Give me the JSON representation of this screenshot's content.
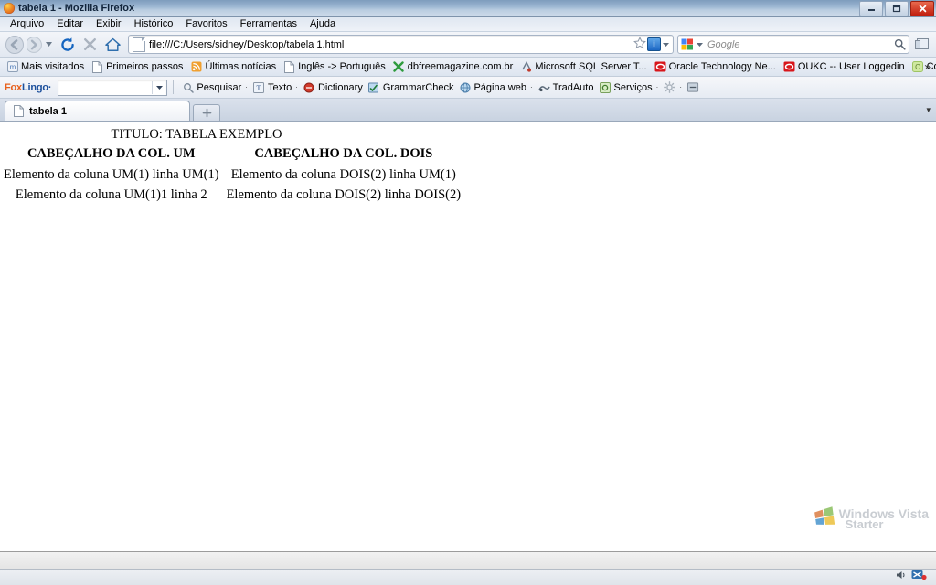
{
  "window": {
    "title": "tabela 1 - Mozilla Firefox",
    "minimize_label": "Minimizar",
    "maximize_label": "Maximizar",
    "close_label": "Fechar"
  },
  "menu": {
    "items": [
      {
        "label": "Arquivo",
        "accel": "A"
      },
      {
        "label": "Editar",
        "accel": "E"
      },
      {
        "label": "Exibir",
        "accel": "x"
      },
      {
        "label": "Histórico",
        "accel": "H"
      },
      {
        "label": "Favoritos",
        "accel": "v"
      },
      {
        "label": "Ferramentas",
        "accel": "F"
      },
      {
        "label": "Ajuda",
        "accel": "j"
      }
    ]
  },
  "navbar": {
    "back_label": "Voltar",
    "forward_label": "Avançar",
    "history_dropdown_label": "Páginas recentes",
    "reload_label": "Recarregar",
    "stop_label": "Parar",
    "home_label": "Página inicial",
    "url": "file:///C:/Users/sidney/Desktop/tabela 1.html",
    "bookmark_star_label": "Adicionar aos favoritos",
    "identity_badge": "i",
    "search": {
      "engine": "Google",
      "placeholder": "Google",
      "value": ""
    },
    "sidebar_button_label": "Painel lateral"
  },
  "bookmarks": {
    "items": [
      {
        "label": "Mais visitados",
        "icon": "most-visited-icon"
      },
      {
        "label": "Primeiros passos",
        "icon": "page-icon"
      },
      {
        "label": "Últimas notícias",
        "icon": "feed-icon"
      },
      {
        "label": "Inglês -> Português",
        "icon": "page-icon"
      },
      {
        "label": "dbfreemagazine.com.br",
        "icon": "green-x-icon"
      },
      {
        "label": "Microsoft SQL Server T...",
        "icon": "sql-server-icon"
      },
      {
        "label": "Oracle Technology Ne...",
        "icon": "oracle-icon"
      },
      {
        "label": "OUKC -- User Loggedin",
        "icon": "oracle-icon"
      },
      {
        "label": "Conjuga-me - Conjug...",
        "icon": "conjugame-icon"
      }
    ],
    "overflow_label": "»"
  },
  "foxlingo": {
    "logo_fox": "Fox",
    "logo_lingo": "Lingo",
    "logo_caret": "·",
    "combo_value": "",
    "items": [
      {
        "label": "Pesquisar",
        "icon": "search-icon",
        "caret": "·"
      },
      {
        "label": "Texto",
        "icon": "text-icon",
        "caret": "·"
      },
      {
        "label": "Dictionary",
        "icon": "dictionary-icon",
        "caret": ""
      },
      {
        "label": "GrammarCheck",
        "icon": "grammar-icon",
        "caret": ""
      },
      {
        "label": "Página web",
        "icon": "webpage-icon",
        "caret": "·"
      },
      {
        "label": "TradAuto",
        "icon": "tradauto-icon",
        "caret": ""
      },
      {
        "label": "Serviços",
        "icon": "services-icon",
        "caret": "·"
      }
    ],
    "settings_label": "Opções",
    "settings_caret": "·",
    "minimize_label": "Recolher barra"
  },
  "tabs": {
    "items": [
      {
        "label": "tabela 1",
        "icon": "page-icon",
        "active": true
      }
    ],
    "new_tab_label": "+",
    "list_all_label": "▾"
  },
  "page": {
    "table": {
      "caption": "TITULO: TABELA EXEMPLO",
      "headers": [
        "CABEÇALHO DA COL. UM",
        "CABEÇALHO DA COL. DOIS"
      ],
      "rows": [
        [
          "Elemento da coluna UM(1) linha UM(1)",
          "Elemento da coluna DOIS(2) linha UM(1)"
        ],
        [
          "Elemento da coluna UM(1)1 linha 2",
          "Elemento da coluna DOIS(2) linha DOIS(2)"
        ]
      ]
    }
  },
  "statusbar": {
    "text": ""
  },
  "watermark": {
    "line1": "Windows Vista",
    "line2": "Starter"
  },
  "colors": {
    "title_bar_top": "#7e9cbd",
    "close_button": "#c01d0d",
    "foxlingo_fox": "#e8601c",
    "foxlingo_lingo": "#1b4f9c",
    "oracle_red": "#d8161b",
    "content_background": "#ffffff",
    "watermark_text": "#c9cdd2"
  }
}
